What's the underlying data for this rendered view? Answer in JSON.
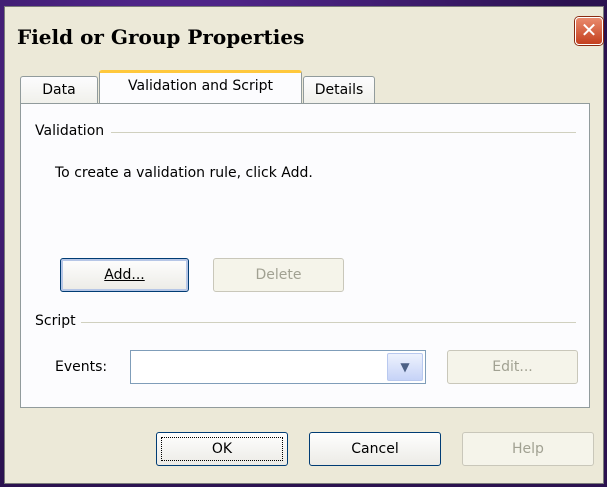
{
  "window": {
    "title": "Field or Group Properties",
    "close_symbol": "✕"
  },
  "tabs": [
    {
      "label": "Data",
      "active": false
    },
    {
      "label": "Validation and Script",
      "active": true
    },
    {
      "label": "Details",
      "active": false
    }
  ],
  "validation": {
    "section_label": "Validation",
    "hint": "To create a validation rule, click Add.",
    "add_label": "Add...",
    "delete_label": "Delete"
  },
  "script": {
    "section_label": "Script",
    "events_label": "Events:",
    "events_value": "",
    "edit_label": "Edit..."
  },
  "buttons": {
    "ok": "OK",
    "cancel": "Cancel",
    "help": "Help"
  }
}
